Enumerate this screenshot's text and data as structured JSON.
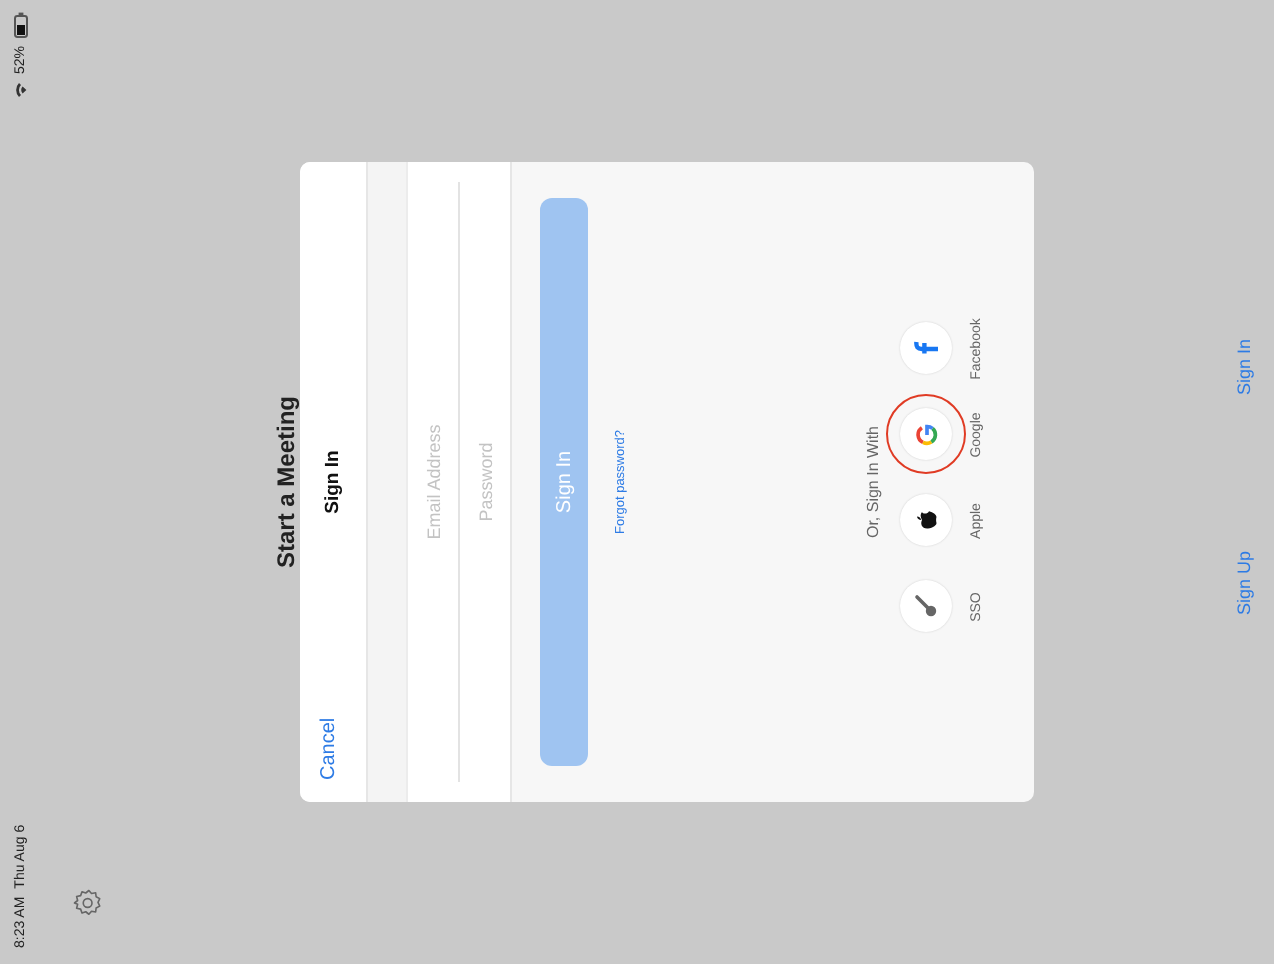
{
  "status_bar": {
    "time": "8:23 AM",
    "date": "Thu Aug 6",
    "battery": "52%"
  },
  "title": "Start a Meeting",
  "dialog": {
    "cancel": "Cancel",
    "heading": "Sign In",
    "fields": [
      {
        "placeholder": "Email Address"
      },
      {
        "placeholder": "Password"
      }
    ],
    "submit": "Sign In",
    "forgot": "Forgot password?",
    "alt_heading": "Or, Sign In With",
    "providers": [
      {
        "label": "SSO",
        "kind": "sso",
        "highlighted": false
      },
      {
        "label": "Apple",
        "kind": "apple",
        "highlighted": false
      },
      {
        "label": "Google",
        "kind": "google",
        "highlighted": true
      },
      {
        "label": "Facebook",
        "kind": "facebook",
        "highlighted": false
      }
    ]
  },
  "bottom_links": [
    "Sign Up",
    "Sign In"
  ]
}
